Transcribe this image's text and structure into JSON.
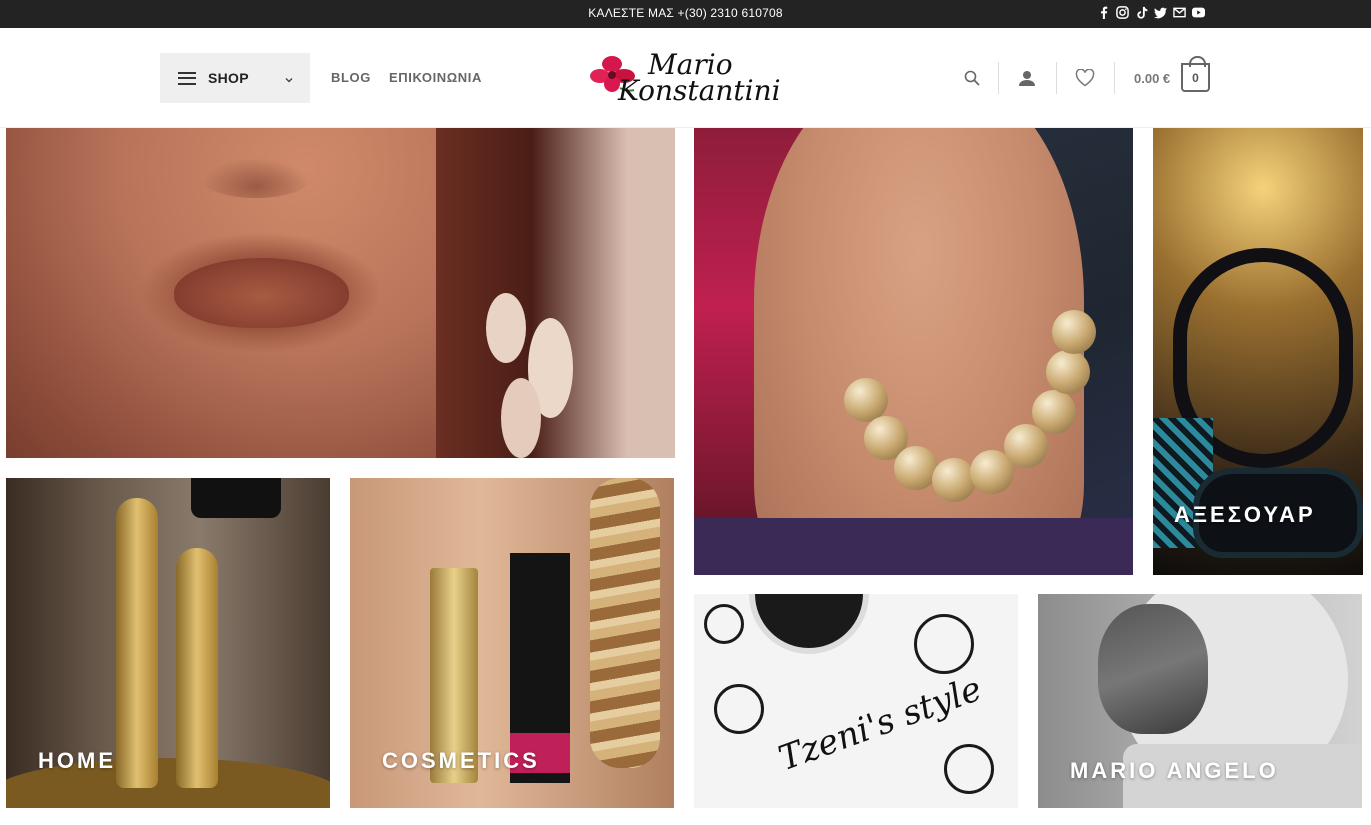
{
  "topbar": {
    "call_text": "ΚΑΛΕΣΤΕ ΜΑΣ +(30) 2310 610708",
    "social": [
      "facebook-icon",
      "instagram-icon",
      "tiktok-icon",
      "twitter-icon",
      "envelope-icon",
      "youtube-icon"
    ]
  },
  "header": {
    "shop_label": "SHOP",
    "nav": [
      "BLOG",
      "ΕΠΙΚΟΙΝΩΝΙΑ"
    ],
    "logo_line1": "Mario",
    "logo_line2": "Konstantini",
    "cart_total": "0.00 €",
    "cart_count": "0"
  },
  "tiles": {
    "accessories": "ΑΞΕΣΟΥΑΡ",
    "home": "HOME",
    "cosmetics": "COSMETICS",
    "tzeni_script": "Tzeni's style",
    "mario_angelo": "MARIO ANGELO"
  },
  "colors": {
    "topbar_bg": "#232323",
    "shop_bg": "#efefef",
    "logo_flower": "#d4174c"
  }
}
